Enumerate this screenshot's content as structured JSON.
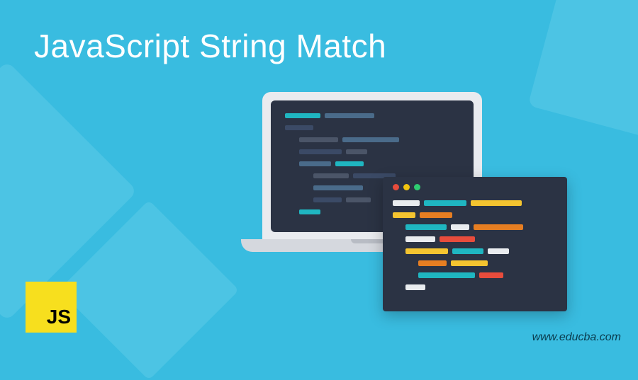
{
  "heading": "JavaScript String Match",
  "js_badge_label": "JS",
  "site_url": "www.educba.com",
  "icons": {
    "js": "javascript-logo-icon",
    "laptop": "laptop-icon",
    "editor": "code-editor-icon"
  },
  "colors": {
    "background": "#39bce0",
    "accent_shape": "#4cc4e4",
    "editor_bg": "#2b3344",
    "laptop_bezel": "#e9ebef",
    "laptop_base": "#d5d8de",
    "js_yellow": "#f7df1e",
    "dot_red": "#e74c3c",
    "dot_yellow": "#f1c40f",
    "dot_green": "#2ecc71"
  }
}
